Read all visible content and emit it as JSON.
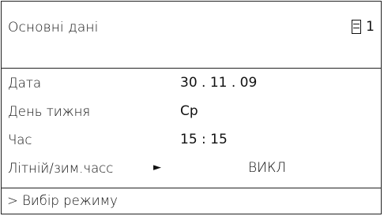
{
  "header": {
    "title": "Основні дані",
    "page_icon": "page-list-icon",
    "page_number": "1"
  },
  "rows": [
    {
      "label": "Дата",
      "value": "30 . 11 . 09"
    },
    {
      "label": "День тижня",
      "value": "Ср"
    },
    {
      "label": "Час",
      "value": "15 : 15"
    },
    {
      "label": "Літній/зим.часс",
      "arrow": "►",
      "value": "ВИКЛ"
    }
  ],
  "footer": {
    "text": "> Вибір режиму"
  }
}
